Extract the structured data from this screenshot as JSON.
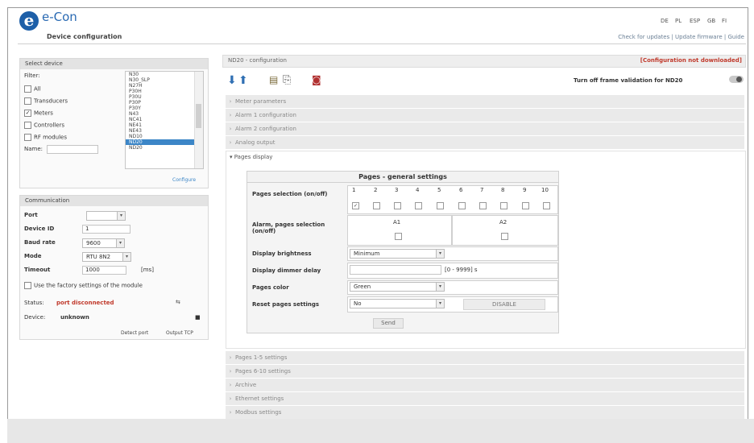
{
  "header": {
    "logo_letter": "e",
    "app_name": "e-Con",
    "subtitle": "Device configuration",
    "languages": [
      "DE",
      "PL",
      "ESP",
      "GB",
      "FI"
    ],
    "top_links": "Check for updates | Update firmware | Guide"
  },
  "select_device": {
    "title": "Select device",
    "filter_label": "Filter:",
    "filters": [
      {
        "label": "All",
        "checked": false
      },
      {
        "label": "Transducers",
        "checked": false
      },
      {
        "label": "Meters",
        "checked": true
      },
      {
        "label": "Controllers",
        "checked": false
      },
      {
        "label": "RF modules",
        "checked": false
      }
    ],
    "name_label": "Name:",
    "devices": [
      "N30",
      "N30_SLP",
      "N27H",
      "P30H",
      "P30U",
      "P30P",
      "P30Y",
      "N43",
      "NC41",
      "NE41",
      "NE43",
      "ND10",
      "ND20"
    ],
    "selected_device": "ND20",
    "configure_link": "Configure"
  },
  "communication": {
    "title": "Communication",
    "port_label": "Port",
    "device_id_label": "Device ID",
    "device_id_value": "1",
    "baud_label": "Baud rate",
    "baud_value": "9600",
    "mode_label": "Mode",
    "mode_value": "RTU 8N2",
    "timeout_label": "Timeout",
    "timeout_value": "1000",
    "timeout_unit": "[ms]",
    "factory_label": "Use the factory settings of the module",
    "status_label": "Status:",
    "status_value": "port disconnected",
    "device_label": "Device:",
    "device_value": "unknown",
    "detect_port": "Detect port",
    "output_tcp": "Output TCP"
  },
  "right": {
    "title": "ND20 - configuration",
    "warning": "[Configuration not downloaded]",
    "turn_off_label": "Turn off frame validation for ND20",
    "sections_top": [
      "Meter parameters",
      "Alarm 1 configuration",
      "Alarm 2 configuration",
      "Analog output"
    ],
    "open_section": "Pages display",
    "sections_bottom": [
      "Pages 1-5 settings",
      "Pages 6-10 settings",
      "Archive",
      "Ethernet settings",
      "Modbus settings"
    ],
    "pages_caption": "Pages - general settings",
    "pages_selection_label": "Pages selection (on/off)",
    "page_numbers": [
      "1",
      "2",
      "3",
      "4",
      "5",
      "6",
      "7",
      "8",
      "9",
      "10"
    ],
    "page_checked": [
      true,
      false,
      false,
      false,
      false,
      false,
      false,
      false,
      false,
      false
    ],
    "alarm_label": "Alarm, pages selection (on/off)",
    "alarm_cols": [
      "A1",
      "A2"
    ],
    "brightness_label": "Display brightness",
    "brightness_value": "Minimum",
    "dimmer_label": "Display dimmer delay",
    "dimmer_unit": "[0 - 9999] s",
    "color_label": "Pages color",
    "color_value": "Green",
    "reset_label": "Reset pages settings",
    "reset_value": "No",
    "disable_button": "DISABLE",
    "send_button": "Send"
  }
}
